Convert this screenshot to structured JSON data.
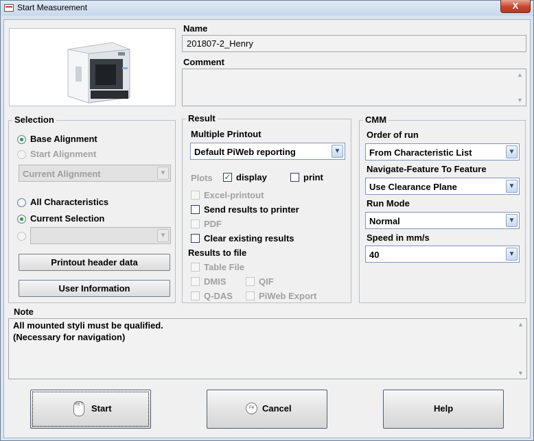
{
  "window": {
    "title": "Start Measurement",
    "close_glyph": "X"
  },
  "name": {
    "label": "Name",
    "value": "201807-2_Henry"
  },
  "comment": {
    "label": "Comment",
    "value": ""
  },
  "selection": {
    "title": "Selection",
    "base_alignment": "Base Alignment",
    "start_alignment": "Start Alignment",
    "alignment_combo": "Current Alignment",
    "all_characteristics": "All Characteristics",
    "current_selection": "Current Selection",
    "selection_combo": "",
    "printout_header_button": "Printout header data",
    "user_information_button": "User Information"
  },
  "result": {
    "title": "Result",
    "multiple_printout_label": "Multiple Printout",
    "multiple_printout_value": "Default PiWeb reporting",
    "plots_label": "Plots",
    "display_label": "display",
    "print_label": "print",
    "excel_printout": "Excel-printout",
    "send_results": "Send results to printer",
    "pdf": "PDF",
    "clear_results": "Clear existing results",
    "results_to_file": "Results to file",
    "table_file": "Table File",
    "dmis": "DMIS",
    "qif": "QIF",
    "qdas": "Q-DAS",
    "piweb_export": "PiWeb Export"
  },
  "cmm": {
    "title": "CMM",
    "order_label": "Order of run",
    "order_value": "From Characteristic List",
    "navigate_label": "Navigate-Feature To Feature",
    "navigate_value": "Use Clearance Plane",
    "run_mode_label": "Run Mode",
    "run_mode_value": "Normal",
    "speed_label": "Speed in mm/s",
    "speed_value": "40"
  },
  "note": {
    "label": "Note",
    "line1": "All mounted styli must be qualified.",
    "line2": "(Necessary for navigation)"
  },
  "buttons": {
    "start": "Start",
    "start_key": "RET",
    "cancel": "Cancel",
    "cancel_key": "F4",
    "help": "Help"
  },
  "icons": {
    "app": "app-window-icon",
    "machine": "cmm-machine-image",
    "checkmark": "✓",
    "dropdown": "▼"
  }
}
